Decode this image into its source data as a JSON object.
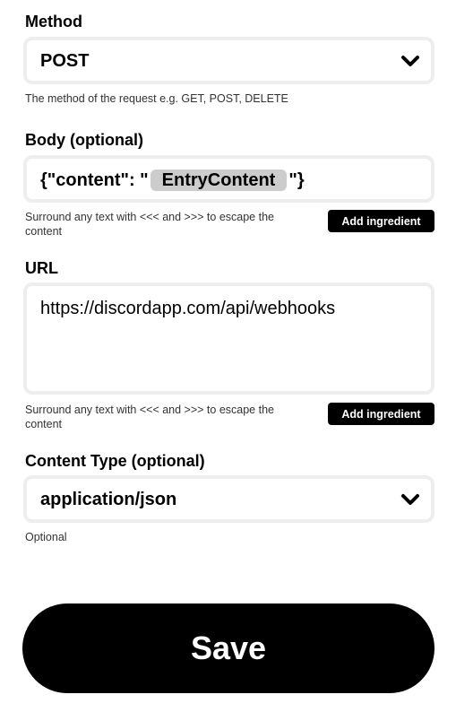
{
  "method": {
    "label": "Method",
    "value": "POST",
    "hint": "The method of the request e.g. GET, POST, DELETE"
  },
  "body": {
    "label": "Body (optional)",
    "prefix": "{\"content\": \"",
    "ingredient": "EntryContent",
    "suffix": "\"}",
    "hint": "Surround any text with <<< and >>> to escape the content",
    "add_ingredient_label": "Add ingredient"
  },
  "url": {
    "label": "URL",
    "value": "https://discordapp.com/api/webhooks",
    "hint": "Surround any text with <<< and >>> to escape the content",
    "add_ingredient_label": "Add ingredient"
  },
  "content_type": {
    "label": "Content Type (optional)",
    "value": "application/json",
    "hint": "Optional"
  },
  "save_label": "Save",
  "colors": {
    "field_border": "#eeeeee",
    "pill": "#cccccc",
    "button": "#000000"
  }
}
